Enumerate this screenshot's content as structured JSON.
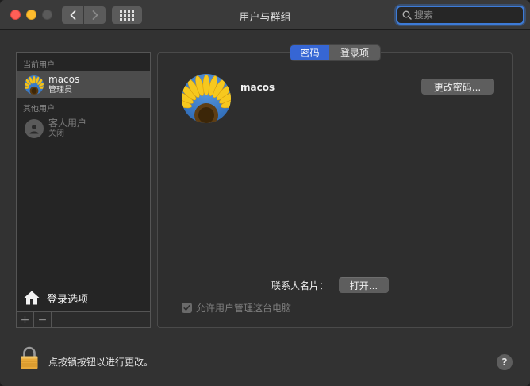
{
  "window": {
    "title": "用户与群组",
    "nav_back_icon": "chevron-left-icon",
    "nav_forward_icon": "chevron-right-icon",
    "grid_icon": "show-all-grid-icon"
  },
  "search": {
    "placeholder": "搜索",
    "icon": "search-icon"
  },
  "sidebar": {
    "current_users_label": "当前用户",
    "other_users_label": "其他用户",
    "current_user": {
      "name": "macos",
      "role": "管理员"
    },
    "guest_user": {
      "name": "客人用户",
      "status": "关闭"
    },
    "login_options_label": "登录选项",
    "add_label": "+",
    "remove_label": "−"
  },
  "tabs": [
    {
      "label": "密码",
      "active": true
    },
    {
      "label": "登录项",
      "active": false
    }
  ],
  "main": {
    "user_name": "macos",
    "change_password_label": "更改密码...",
    "contacts_card_label": "联系人名片：",
    "open_label": "打开...",
    "allow_admin_label": "允许用户管理这台电脑",
    "allow_admin_checked": true
  },
  "footer": {
    "lock_text": "点按锁按钮以进行更改。",
    "help_label": "?"
  },
  "colors": {
    "accent": "#3666d4",
    "search_focus": "#3d7bd7",
    "close": "#fe5f57",
    "minimize": "#febc2e",
    "zoom_disabled": "#5a5a5a",
    "lock": "#e8a93a"
  }
}
